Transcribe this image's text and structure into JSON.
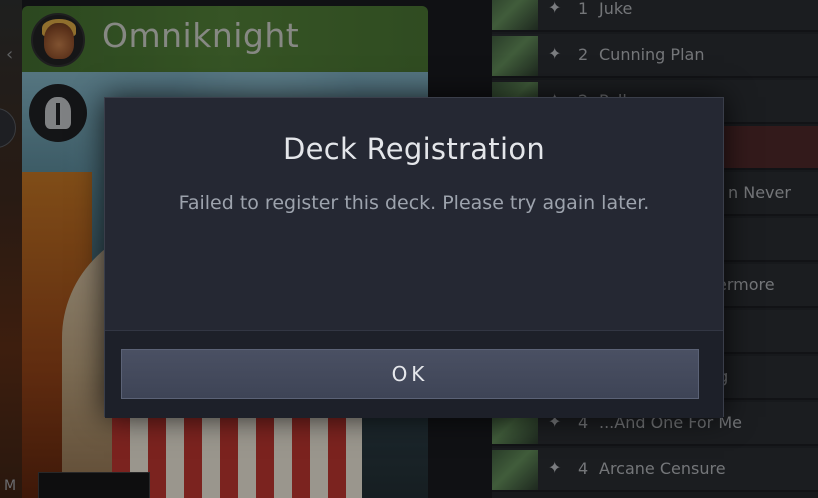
{
  "hero": {
    "name": "Omniknight",
    "bottom_label": "M"
  },
  "card_list": [
    {
      "mana": "✦",
      "count": "1",
      "name": "Juke"
    },
    {
      "mana": "✦",
      "count": "2",
      "name": "Cunning Plan"
    },
    {
      "mana": "✦",
      "count": "2",
      "name": "Poll"
    },
    {
      "mana": "✦",
      "count": "",
      "name": "ng"
    },
    {
      "mana": "✦",
      "count": "",
      "name": "n Never"
    },
    {
      "mana": "✦",
      "count": "",
      "name": ""
    },
    {
      "mana": "✦",
      "count": "",
      "name": "ermore"
    },
    {
      "mana": "✦",
      "count": "",
      "name": "e"
    },
    {
      "mana": "✦",
      "count": "",
      "name": "ng"
    },
    {
      "mana": "✦",
      "count": "4",
      "name": "...And One For Me"
    },
    {
      "mana": "✦",
      "count": "4",
      "name": "Arcane Censure"
    }
  ],
  "modal": {
    "title": "Deck Registration",
    "message": "Failed to register this deck. Please try again later.",
    "ok_label": "OK"
  }
}
